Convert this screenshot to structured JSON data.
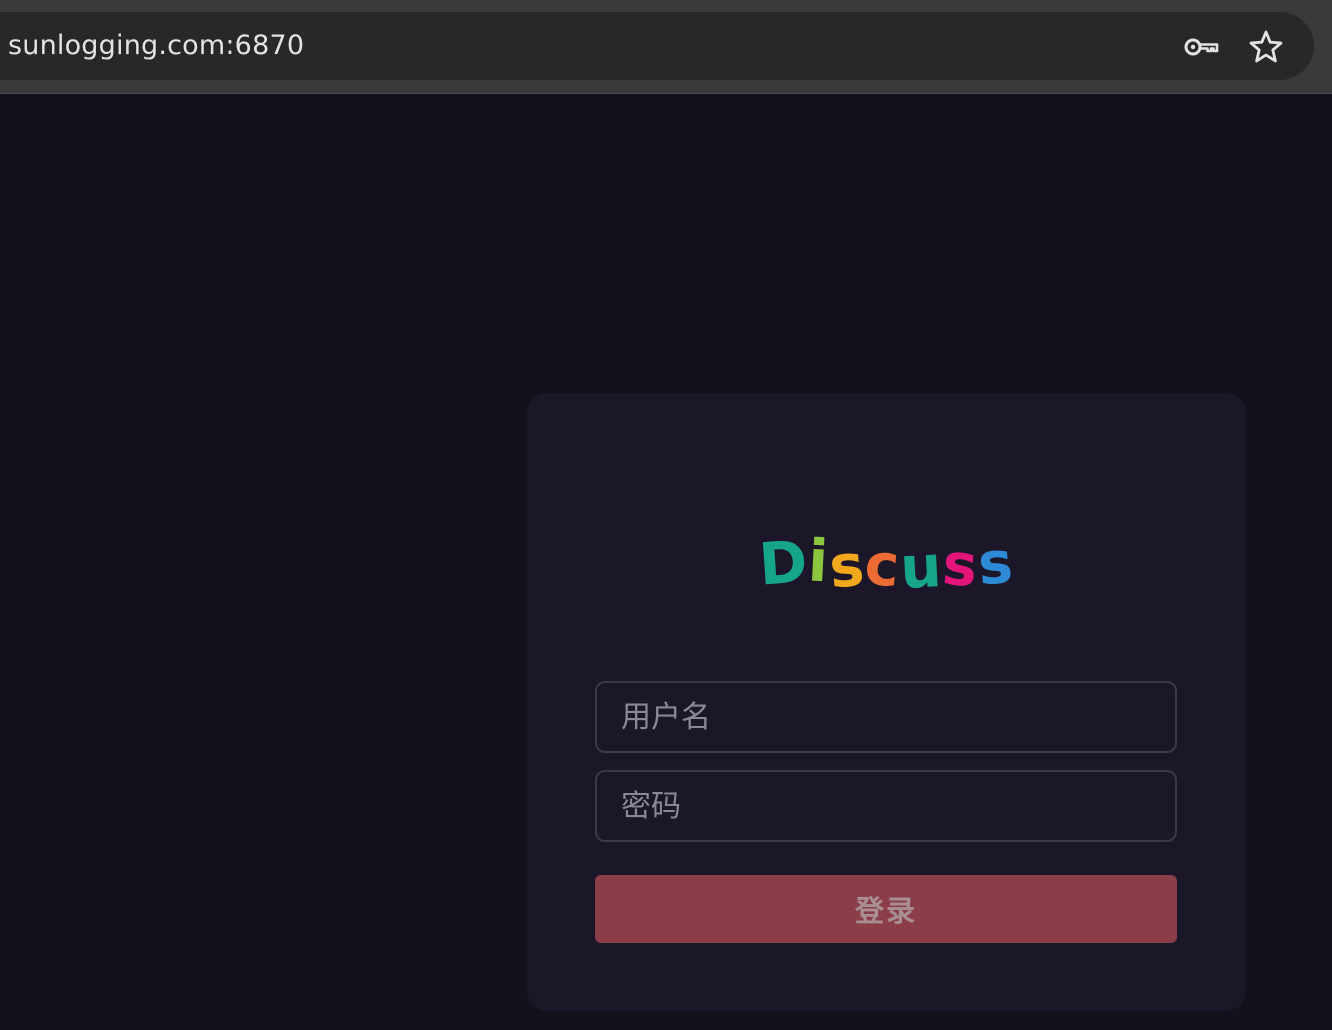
{
  "browser": {
    "url": "sunlogging.com:6870",
    "icons": {
      "password_manager": "key-icon",
      "bookmark": "star-icon"
    }
  },
  "login": {
    "logo_letters": [
      {
        "char": "D",
        "color": "#16a589"
      },
      {
        "char": "i",
        "color": "#8cc63f"
      },
      {
        "char": "s",
        "color": "#f2a81d"
      },
      {
        "char": "c",
        "color": "#ec6a34"
      },
      {
        "char": "u",
        "color": "#16a589"
      },
      {
        "char": "s",
        "color": "#e4157a"
      },
      {
        "char": "s",
        "color": "#2d8ad6"
      }
    ],
    "username_placeholder": "用户名",
    "password_placeholder": "密码",
    "submit_label": "登录"
  },
  "colors": {
    "page_background": "#13111c",
    "card_background": "#1b1729",
    "button_background": "#8c3e48"
  }
}
